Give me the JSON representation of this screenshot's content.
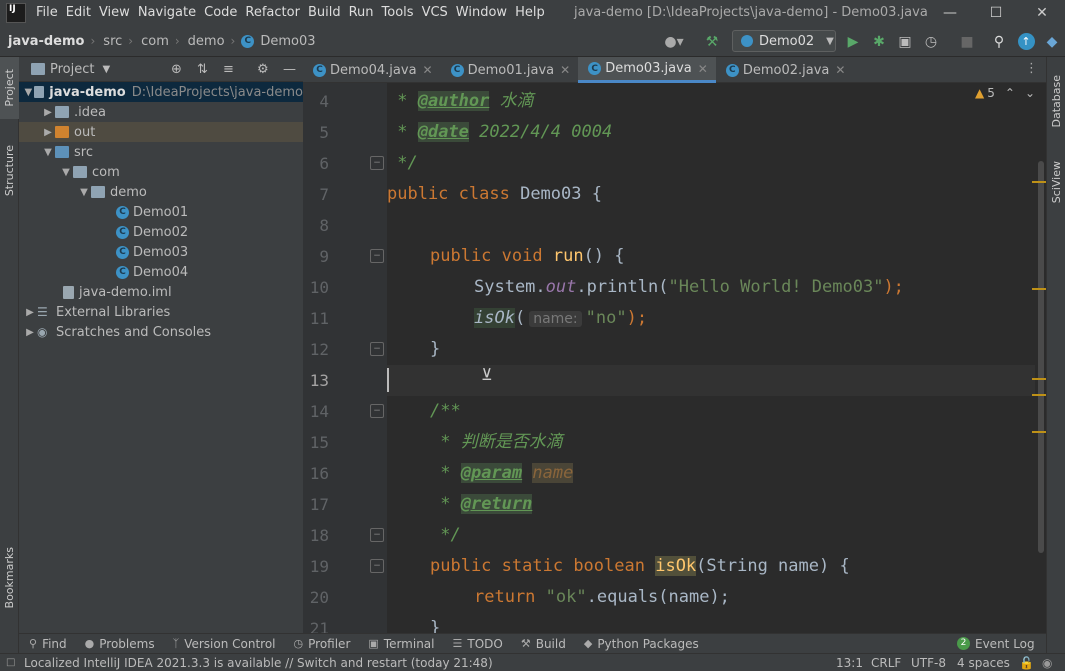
{
  "app": {
    "logo": "IJ",
    "menu": [
      "File",
      "Edit",
      "View",
      "Navigate",
      "Code",
      "Refactor",
      "Build",
      "Run",
      "Tools",
      "VCS",
      "Window",
      "Help"
    ],
    "window_title": "java-demo [D:\\IdeaProjects\\java-demo] - Demo03.java"
  },
  "breadcrumb": {
    "project": "java-demo",
    "items": [
      "src",
      "com",
      "demo",
      "Demo03"
    ]
  },
  "toolbar": {
    "run_config": "Demo02"
  },
  "left_strip": {
    "project": "Project",
    "structure": "Structure",
    "bookmarks": "Bookmarks"
  },
  "right_strip": {
    "database": "Database",
    "sciview": "SciView"
  },
  "project_panel": {
    "title": "Project",
    "tree": [
      {
        "label": "java-demo",
        "path": "D:\\IdeaProjects\\java-demo"
      },
      {
        "label": ".idea"
      },
      {
        "label": "out"
      },
      {
        "label": "src"
      },
      {
        "label": "com"
      },
      {
        "label": "demo"
      },
      {
        "label": "Demo01"
      },
      {
        "label": "Demo02"
      },
      {
        "label": "Demo03"
      },
      {
        "label": "Demo04"
      },
      {
        "label": "java-demo.iml"
      },
      {
        "label": "External Libraries"
      },
      {
        "label": "Scratches and Consoles"
      }
    ]
  },
  "tabs": [
    {
      "label": "Demo04.java"
    },
    {
      "label": "Demo01.java"
    },
    {
      "label": "Demo03.java"
    },
    {
      "label": "Demo02.java"
    }
  ],
  "editor": {
    "warnings": "5",
    "line_numbers": [
      "4",
      "5",
      "6",
      "7",
      "8",
      "9",
      "10",
      "11",
      "12",
      "13",
      "14",
      "15",
      "16",
      "17",
      "18",
      "19",
      "20",
      "21"
    ],
    "t": {
      "star": " * ",
      "author_tag": "@author",
      "author_val": " 水滴",
      "date_tag": "@date",
      "date_val": " 2022/4/4 0004",
      "end_doc": " */",
      "public": "public",
      "class": " class",
      "classname": " Demo03 {",
      "void": " void",
      "run": " run",
      "run_rest": "() {",
      "system": "System.",
      "out": "out",
      "println": ".println(",
      "hello": "\"Hello World! Demo03\"",
      "close_semi": ");",
      "isok": "isOk",
      "paren": "(",
      "hint_name": "name:",
      "no": "\"no\"",
      "brace_close": "}",
      "doc_open": "/**",
      "doc_star": " * ",
      "doc_text": "判断是否水滴",
      "param_tag": "@param",
      "param_name": "name",
      "return_tag": "@return",
      "doc_end": " */",
      "static": " static",
      "boolean": " boolean",
      "isok_sig": "(String name) {",
      "return": "return",
      "ok": "\"ok\"",
      "equals": ".equals(name);"
    }
  },
  "toolwindows": [
    "Find",
    "Problems",
    "Version Control",
    "Profiler",
    "Terminal",
    "TODO",
    "Build",
    "Python Packages",
    "Event Log"
  ],
  "event_count": "2",
  "status": {
    "message": "Localized IntelliJ IDEA 2021.3.3 is available // Switch and restart (today 21:48)",
    "position": "13:1",
    "line_sep": "CRLF",
    "encoding": "UTF-8",
    "indent": "4 spaces"
  }
}
